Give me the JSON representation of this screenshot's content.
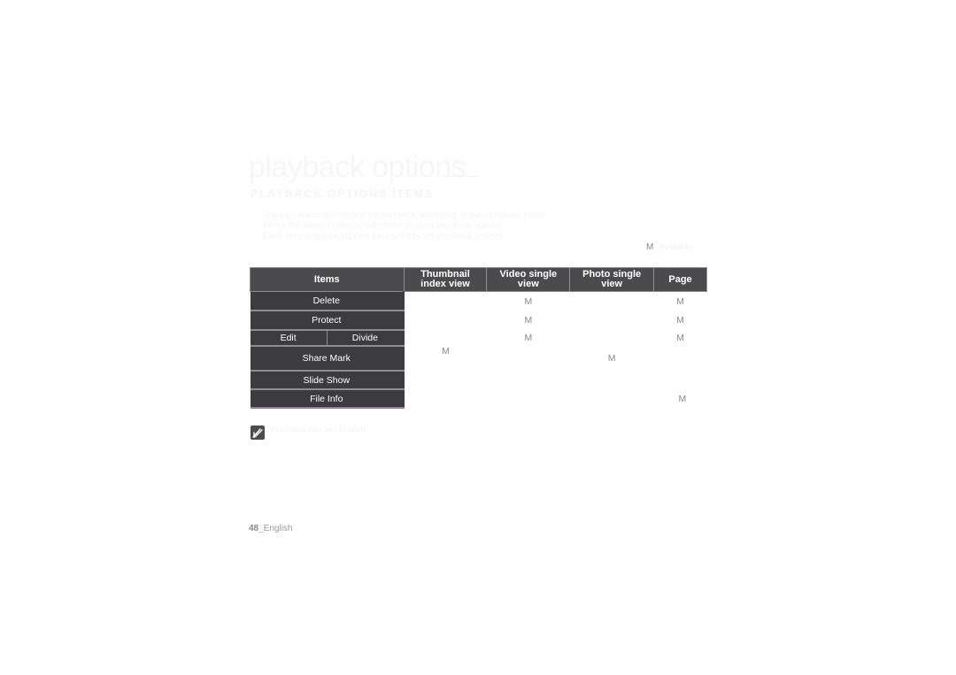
{
  "page": {
    "title": "playback options",
    "subtitle": "PLAYBACK OPTIONS ITEMS",
    "intro_lines": [
      "You can select the options for playback according to the operation mode.",
      "Press the Menu button to select the desired playback options.",
      "Each item is displayed with the currently set playback options."
    ],
    "top_mark": "M",
    "top_mark_note": "Available"
  },
  "table": {
    "headers": [
      "Items",
      "Thumbnail index view",
      "Video single view",
      "Photo single view",
      "Page"
    ],
    "rows": [
      {
        "item": "Delete",
        "thumbnail": "",
        "video": "M",
        "photo": "",
        "page": "M"
      },
      {
        "item": "Protect",
        "thumbnail": "",
        "video": "M",
        "photo": "",
        "page": "M"
      },
      {
        "item_left": "Edit",
        "item_right": "Divide",
        "thumbnail": "",
        "video": "M",
        "photo": "",
        "page": "M"
      },
      {
        "item": "Share Mark",
        "thumbnail": "M",
        "video": "",
        "photo": "M",
        "page": ""
      },
      {
        "item": "Slide Show",
        "thumbnail": "",
        "video": "",
        "photo": "",
        "page": ""
      },
      {
        "item": "File Info",
        "thumbnail": "",
        "video": "",
        "photo": "",
        "page": "M"
      }
    ]
  },
  "note": {
    "icon": "note-pencil-icon",
    "text": "Menu items may vary by mode."
  },
  "footer": {
    "page_number": "48",
    "language": "_English"
  }
}
